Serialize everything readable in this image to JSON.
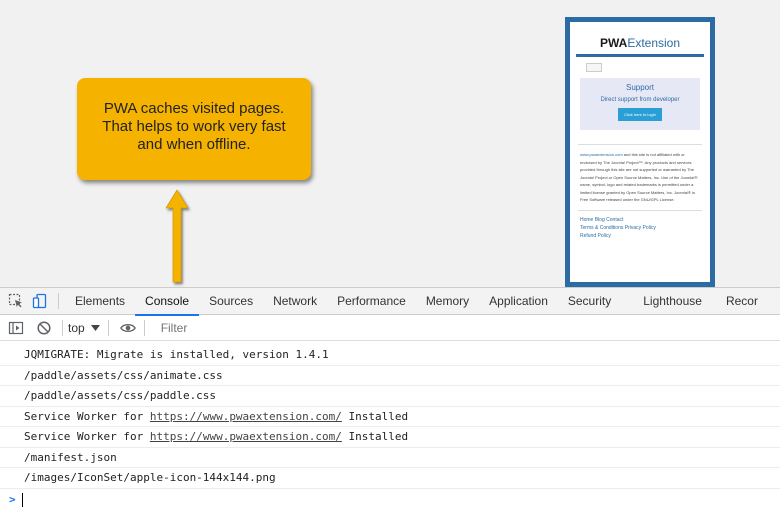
{
  "phone": {
    "logo_a": "PWA",
    "logo_b": "Extension",
    "support_title": "Support",
    "support_sub": "Direct support from developer",
    "support_button": "Click here to login",
    "legal_link": "www.pwaextension.com",
    "legal_text": " and this site is not affiliated with or endorsed by The Joomla! Project™. Any products and services provided through this site are not supported or warranted by The Joomla! Project or Open Source Matters, Inc. Use of the Joomla!® name, symbol, logo and related trademarks is permitted under a limited license granted by Open Source Matters, Inc. Joomla!® is Free Software released under the GNU/GPL License.",
    "footer_links": [
      "Home",
      "Blog",
      "Contact"
    ],
    "footer_links2": [
      "Terms & Conditions",
      "Privacy Policy"
    ],
    "footer_links3": [
      "Refund Policy"
    ]
  },
  "callout": {
    "line1": "PWA caches visited pages.",
    "line2": "That helps to work very fast",
    "line3": "and when offline."
  },
  "colors": {
    "callout_bg": "#f5b300",
    "arrow": "#f5b300",
    "brand": "#2d6ca2",
    "active_tab": "#1a73e8"
  },
  "devtools": {
    "tabs": [
      "Elements",
      "Console",
      "Sources",
      "Network",
      "Performance",
      "Memory",
      "Application",
      "Security",
      "Lighthouse",
      "Recor"
    ],
    "active_tab": "Console",
    "context": "top",
    "filter_placeholder": "Filter",
    "console_lines": [
      {
        "text": "JQMIGRATE: Migrate is installed, version 1.4.1"
      },
      {
        "text": "/paddle/assets/css/animate.css"
      },
      {
        "text": "/paddle/assets/css/paddle.css"
      },
      {
        "pre": "Service Worker for ",
        "link": "https://www.pwaextension.com/",
        "post": " Installed"
      },
      {
        "pre": "Service Worker for ",
        "link": "https://www.pwaextension.com/",
        "post": " Installed"
      },
      {
        "text": "/manifest.json"
      },
      {
        "text": "/images/IconSet/apple-icon-144x144.png"
      }
    ],
    "prompt": ">"
  }
}
